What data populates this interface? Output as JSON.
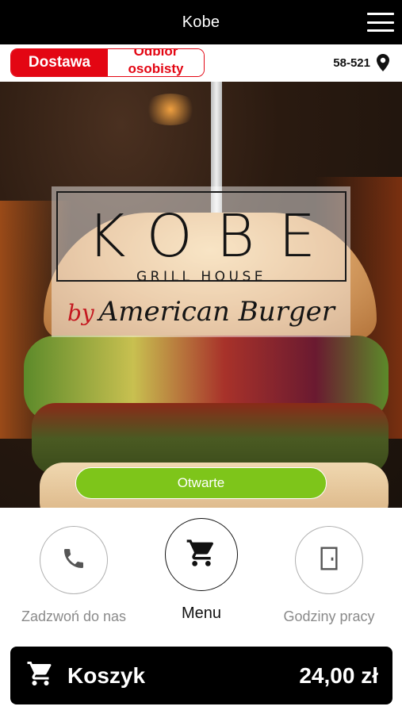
{
  "header": {
    "title": "Kobe",
    "menu_icon": "hamburger-menu-icon"
  },
  "order_mode": {
    "options": [
      "Dostawa",
      "Odbiór osobisty"
    ],
    "selected": "Dostawa",
    "accent_color": "#e30613"
  },
  "location": {
    "postcode": "58-521",
    "icon": "map-pin-icon"
  },
  "hero": {
    "logo": {
      "name": "KOBE",
      "tagline": "GRILL HOUSE",
      "script_prefix": "by",
      "script_text": "American Burger"
    },
    "status_label": "Otwarte",
    "status_color": "#7ec51a"
  },
  "actions": [
    {
      "label": "Zadzwoń do nas",
      "icon": "phone-icon"
    },
    {
      "label": "Menu",
      "icon": "cart-icon"
    },
    {
      "label": "Godziny pracy",
      "icon": "door-icon"
    }
  ],
  "cart": {
    "label": "Koszyk",
    "total": "24,00 zł",
    "icon": "cart-icon"
  }
}
